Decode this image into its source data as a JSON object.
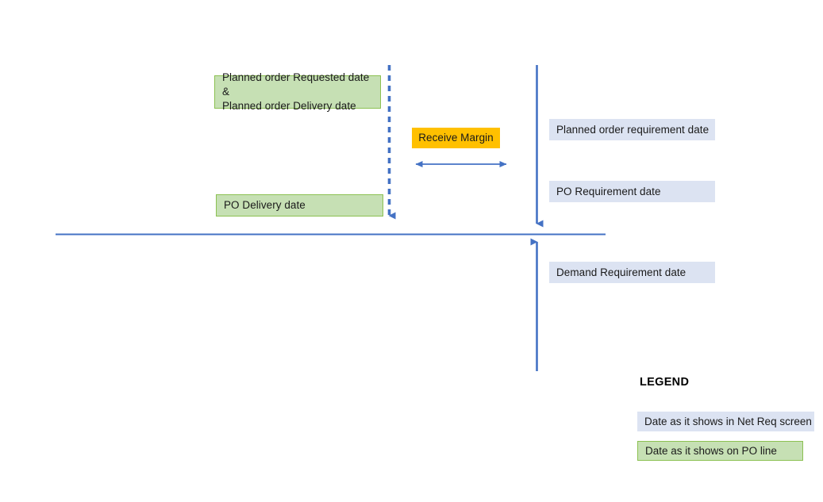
{
  "diagram": {
    "title": "Planned order / PO date timeline",
    "colors": {
      "line_blue": "#4472C4",
      "green_fill": "#C6E0B4",
      "green_border": "#8CC152",
      "blue_fill": "#DCE3F2",
      "amber_fill": "#FFC000",
      "text": "#1a1a1a"
    },
    "boxes": [
      {
        "id": "planned-order-requested-delivery",
        "label": "Planned order Requested date &\nPlanned order Delivery date",
        "style": "green"
      },
      {
        "id": "po-delivery-date",
        "label": "PO Delivery date",
        "style": "green"
      },
      {
        "id": "receive-margin",
        "label": "Receive Margin",
        "style": "amber"
      },
      {
        "id": "planned-order-requirement-date",
        "label": "Planned order requirement date",
        "style": "blue"
      },
      {
        "id": "po-requirement-date",
        "label": "PO Requirement date",
        "style": "blue"
      },
      {
        "id": "demand-requirement-date",
        "label": "Demand Requirement date",
        "style": "blue"
      }
    ]
  },
  "legend": {
    "title": "LEGEND",
    "items": [
      {
        "id": "legend-net-req",
        "label": "Date as it shows in Net Req screen",
        "style": "blue"
      },
      {
        "id": "legend-po-line",
        "label": "Date as it shows on PO line",
        "style": "green"
      }
    ]
  }
}
